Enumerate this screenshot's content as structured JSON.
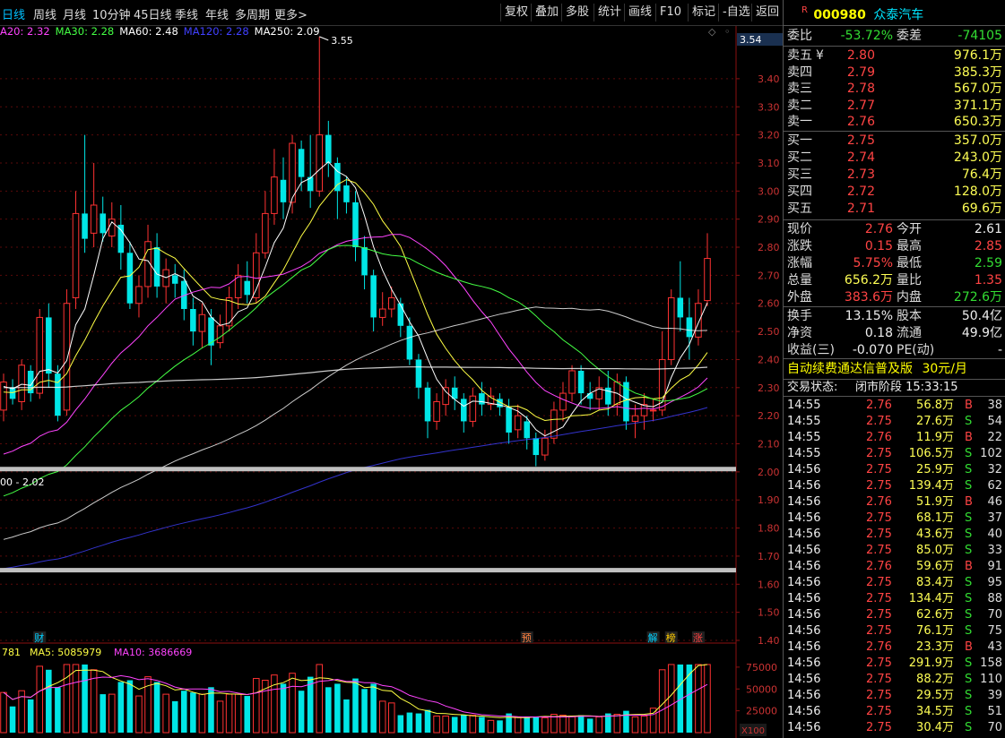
{
  "toolbar": {
    "periods": [
      "日线",
      "周线",
      "月线",
      "10分钟",
      "45日线",
      "季线",
      "年线",
      "多周期",
      "更多>"
    ],
    "active_period": 0,
    "tools": [
      "复权",
      "叠加",
      "多股",
      "统计",
      "画线",
      "F10",
      "标记",
      "-自选",
      "返回"
    ]
  },
  "ma_legend": [
    {
      "text": "A20: 2.32",
      "color": "#ff44ff"
    },
    {
      "text": "MA30: 2.28",
      "color": "#44ff44"
    },
    {
      "text": "MA60: 2.48",
      "color": "#ffffff"
    },
    {
      "text": "MA120: 2.28",
      "color": "#4040ff"
    },
    {
      "text": "MA250: 2.09",
      "color": "#ffffff"
    }
  ],
  "chart_data": {
    "type": "candlestick",
    "price_axis": [
      "3.40",
      "3.30",
      "3.20",
      "3.10",
      "3.00",
      "2.90",
      "2.80",
      "2.70",
      "2.60",
      "2.50",
      "2.40",
      "2.30",
      "2.20",
      "2.10",
      "2.00",
      "1.90",
      "1.80",
      "1.70",
      "1.60",
      "1.50",
      "1.40"
    ],
    "ylim": [
      1.4,
      3.54
    ],
    "current_price_label": "3.54",
    "high_annotation": "3.55",
    "low_annotation": "00 - 2.02",
    "candles": [
      [
        2.22,
        2.32,
        2.18,
        2.35
      ],
      [
        2.3,
        2.26,
        2.24,
        2.33
      ],
      [
        2.25,
        2.38,
        2.22,
        2.4
      ],
      [
        2.36,
        2.28,
        2.25,
        2.38
      ],
      [
        2.28,
        2.55,
        2.26,
        2.58
      ],
      [
        2.55,
        2.35,
        2.3,
        2.6
      ],
      [
        2.35,
        2.2,
        2.18,
        2.38
      ],
      [
        2.22,
        2.6,
        2.2,
        2.65
      ],
      [
        2.62,
        2.92,
        2.58,
        3.0
      ],
      [
        2.92,
        2.83,
        2.78,
        3.2
      ],
      [
        2.85,
        2.95,
        2.8,
        3.1
      ],
      [
        2.92,
        2.85,
        2.82,
        2.98
      ],
      [
        2.84,
        2.9,
        2.8,
        2.96
      ],
      [
        2.88,
        2.78,
        2.72,
        2.95
      ],
      [
        2.78,
        2.6,
        2.58,
        2.82
      ],
      [
        2.6,
        2.66,
        2.55,
        2.7
      ],
      [
        2.66,
        2.82,
        2.62,
        2.88
      ],
      [
        2.8,
        2.66,
        2.62,
        2.85
      ],
      [
        2.66,
        2.72,
        2.6,
        2.76
      ],
      [
        2.7,
        2.67,
        2.62,
        2.74
      ],
      [
        2.68,
        2.58,
        2.54,
        2.72
      ],
      [
        2.58,
        2.5,
        2.45,
        2.62
      ],
      [
        2.5,
        2.56,
        2.44,
        2.6
      ],
      [
        2.55,
        2.45,
        2.38,
        2.58
      ],
      [
        2.46,
        2.52,
        2.44,
        2.56
      ],
      [
        2.52,
        2.62,
        2.5,
        2.66
      ],
      [
        2.62,
        2.7,
        2.58,
        2.74
      ],
      [
        2.68,
        2.63,
        2.6,
        2.75
      ],
      [
        2.62,
        2.78,
        2.6,
        2.85
      ],
      [
        2.78,
        2.92,
        2.76,
        3.0
      ],
      [
        2.92,
        3.05,
        2.88,
        3.15
      ],
      [
        3.04,
        2.96,
        2.9,
        3.12
      ],
      [
        2.96,
        3.17,
        2.92,
        3.2
      ],
      [
        3.15,
        3.05,
        3.0,
        3.18
      ],
      [
        3.05,
        3.0,
        2.94,
        3.2
      ],
      [
        3.0,
        3.2,
        2.98,
        3.55
      ],
      [
        3.2,
        3.1,
        3.05,
        3.25
      ],
      [
        3.1,
        3.0,
        2.9,
        3.12
      ],
      [
        3.02,
        2.96,
        2.92,
        3.05
      ],
      [
        2.96,
        2.8,
        2.75,
        3.0
      ],
      [
        2.8,
        2.7,
        2.65,
        2.84
      ],
      [
        2.7,
        2.55,
        2.5,
        2.72
      ],
      [
        2.55,
        2.58,
        2.52,
        2.64
      ],
      [
        2.58,
        2.62,
        2.55,
        2.66
      ],
      [
        2.6,
        2.52,
        2.48,
        2.62
      ],
      [
        2.52,
        2.4,
        2.38,
        2.55
      ],
      [
        2.4,
        2.3,
        2.26,
        2.42
      ],
      [
        2.3,
        2.18,
        2.12,
        2.32
      ],
      [
        2.18,
        2.25,
        2.15,
        2.28
      ],
      [
        2.24,
        2.3,
        2.2,
        2.33
      ],
      [
        2.3,
        2.26,
        2.22,
        2.34
      ],
      [
        2.26,
        2.18,
        2.14,
        2.28
      ],
      [
        2.18,
        2.27,
        2.16,
        2.3
      ],
      [
        2.28,
        2.24,
        2.2,
        2.32
      ],
      [
        2.24,
        2.27,
        2.22,
        2.3
      ],
      [
        2.26,
        2.23,
        2.2,
        2.28
      ],
      [
        2.23,
        2.14,
        2.1,
        2.26
      ],
      [
        2.15,
        2.2,
        2.12,
        2.24
      ],
      [
        2.18,
        2.12,
        2.08,
        2.2
      ],
      [
        2.12,
        2.06,
        2.02,
        2.14
      ],
      [
        2.06,
        2.12,
        2.04,
        2.15
      ],
      [
        2.12,
        2.22,
        2.1,
        2.25
      ],
      [
        2.22,
        2.28,
        2.18,
        2.32
      ],
      [
        2.28,
        2.36,
        2.25,
        2.38
      ],
      [
        2.36,
        2.28,
        2.24,
        2.38
      ],
      [
        2.28,
        2.26,
        2.22,
        2.32
      ],
      [
        2.26,
        2.3,
        2.22,
        2.34
      ],
      [
        2.3,
        2.24,
        2.2,
        2.36
      ],
      [
        2.24,
        2.32,
        2.2,
        2.35
      ],
      [
        2.32,
        2.18,
        2.15,
        2.34
      ],
      [
        2.18,
        2.2,
        2.12,
        2.24
      ],
      [
        2.2,
        2.24,
        2.15,
        2.28
      ],
      [
        2.22,
        2.22,
        2.18,
        2.26
      ],
      [
        2.22,
        2.4,
        2.2,
        2.5
      ],
      [
        2.4,
        2.62,
        2.38,
        2.65
      ],
      [
        2.62,
        2.55,
        2.5,
        2.75
      ],
      [
        2.55,
        2.48,
        2.4,
        2.62
      ],
      [
        2.48,
        2.6,
        2.45,
        2.65
      ],
      [
        2.61,
        2.76,
        2.59,
        2.85
      ]
    ],
    "ma_lines": [
      {
        "name": "MA5",
        "color": "#ffffff"
      },
      {
        "name": "MA10",
        "color": "#ffff44"
      },
      {
        "name": "MA20",
        "color": "#ff44ff"
      },
      {
        "name": "MA30",
        "color": "#44ff44"
      },
      {
        "name": "MA60",
        "color": "#ffffff"
      },
      {
        "name": "MA120",
        "color": "#4040ff"
      },
      {
        "name": "MA250",
        "color": "#ffffff"
      }
    ],
    "markers": [
      {
        "text": "财",
        "color": "#00d0ff",
        "index": 4
      },
      {
        "text": "预",
        "color": "#ff8040",
        "index": 58
      },
      {
        "text": "解",
        "color": "#00d0ff",
        "index": 72
      },
      {
        "text": "榜",
        "color": "#ffcc00",
        "index": 74
      },
      {
        "text": "涨",
        "color": "#ff4040",
        "index": 77
      }
    ],
    "volume": {
      "legend": [
        {
          "text": "781",
          "color": "#ffff44"
        },
        {
          "text": "MA5: 5085979",
          "color": "#ffff44"
        },
        {
          "text": "MA10: 3686669",
          "color": "#ff44ff"
        }
      ],
      "axis": [
        "75000",
        "50000",
        "25000"
      ],
      "unit": "X100",
      "ylim": [
        0,
        80000
      ]
    }
  },
  "quote": {
    "badge": "R",
    "code": "000980",
    "name": "众泰汽车",
    "weibi_label": "委比",
    "weibi_value": "-53.72%",
    "weicha_label": "委差",
    "weicha_value": "-74105",
    "asks": [
      {
        "label": "卖五",
        "mark": "¥",
        "price": "2.80",
        "vol": "976.1万"
      },
      {
        "label": "卖四",
        "mark": "",
        "price": "2.79",
        "vol": "385.3万"
      },
      {
        "label": "卖三",
        "mark": "",
        "price": "2.78",
        "vol": "567.0万"
      },
      {
        "label": "卖二",
        "mark": "",
        "price": "2.77",
        "vol": "371.1万"
      },
      {
        "label": "卖一",
        "mark": "",
        "price": "2.76",
        "vol": "650.3万"
      }
    ],
    "bids": [
      {
        "label": "买一",
        "price": "2.75",
        "vol": "357.0万"
      },
      {
        "label": "买二",
        "price": "2.74",
        "vol": "243.0万"
      },
      {
        "label": "买三",
        "price": "2.73",
        "vol": "76.4万"
      },
      {
        "label": "买四",
        "price": "2.72",
        "vol": "128.0万"
      },
      {
        "label": "买五",
        "price": "2.71",
        "vol": "69.6万"
      }
    ],
    "stats": [
      {
        "l1": "现价",
        "v1": "2.76",
        "c1": "red",
        "l2": "今开",
        "v2": "2.61",
        "c2": "white"
      },
      {
        "l1": "涨跌",
        "v1": "0.15",
        "c1": "red",
        "l2": "最高",
        "v2": "2.85",
        "c2": "red"
      },
      {
        "l1": "涨幅",
        "v1": "5.75%",
        "c1": "red",
        "l2": "最低",
        "v2": "2.59",
        "c2": "green"
      },
      {
        "l1": "总量",
        "v1": "656.2万",
        "c1": "yellow",
        "l2": "量比",
        "v2": "1.35",
        "c2": "red"
      },
      {
        "l1": "外盘",
        "v1": "383.6万",
        "c1": "red",
        "l2": "内盘",
        "v2": "272.6万",
        "c2": "green"
      }
    ],
    "stats2": [
      {
        "l1": "换手",
        "v1": "13.15%",
        "l2": "股本",
        "v2": "50.4亿"
      },
      {
        "l1": "净资",
        "v1": "0.18",
        "l2": "流通",
        "v2": "49.9亿"
      },
      {
        "l1": "收益(三)",
        "v1": "-0.070",
        "l2": "PE(动)",
        "v2": "-"
      }
    ],
    "promo": "自动续费通达信普及版",
    "promo_price": "30元/月",
    "status_label": "交易状态:",
    "status_value": "闭市阶段 15:33:15",
    "ticks": [
      [
        "14:55",
        "2.76",
        "56.8万",
        "B",
        "38"
      ],
      [
        "14:55",
        "2.75",
        "27.6万",
        "S",
        "54"
      ],
      [
        "14:55",
        "2.76",
        "11.9万",
        "B",
        "22"
      ],
      [
        "14:55",
        "2.75",
        "106.5万",
        "S",
        "102"
      ],
      [
        "14:56",
        "2.75",
        "25.9万",
        "S",
        "32"
      ],
      [
        "14:56",
        "2.75",
        "139.4万",
        "S",
        "62"
      ],
      [
        "14:56",
        "2.76",
        "51.9万",
        "B",
        "46"
      ],
      [
        "14:56",
        "2.75",
        "68.1万",
        "S",
        "37"
      ],
      [
        "14:56",
        "2.75",
        "43.6万",
        "S",
        "40"
      ],
      [
        "14:56",
        "2.75",
        "85.0万",
        "S",
        "33"
      ],
      [
        "14:56",
        "2.76",
        "59.6万",
        "B",
        "91"
      ],
      [
        "14:56",
        "2.75",
        "83.4万",
        "S",
        "95"
      ],
      [
        "14:56",
        "2.75",
        "134.4万",
        "S",
        "88"
      ],
      [
        "14:56",
        "2.75",
        "62.6万",
        "S",
        "70"
      ],
      [
        "14:56",
        "2.75",
        "76.1万",
        "S",
        "75"
      ],
      [
        "14:56",
        "2.76",
        "23.3万",
        "B",
        "43"
      ],
      [
        "14:56",
        "2.75",
        "291.9万",
        "S",
        "158"
      ],
      [
        "14:56",
        "2.75",
        "88.2万",
        "S",
        "110"
      ],
      [
        "14:56",
        "2.75",
        "29.5万",
        "S",
        "39"
      ],
      [
        "14:56",
        "2.75",
        "34.5万",
        "S",
        "51"
      ],
      [
        "14:56",
        "2.75",
        "30.4万",
        "S",
        "70"
      ]
    ]
  }
}
